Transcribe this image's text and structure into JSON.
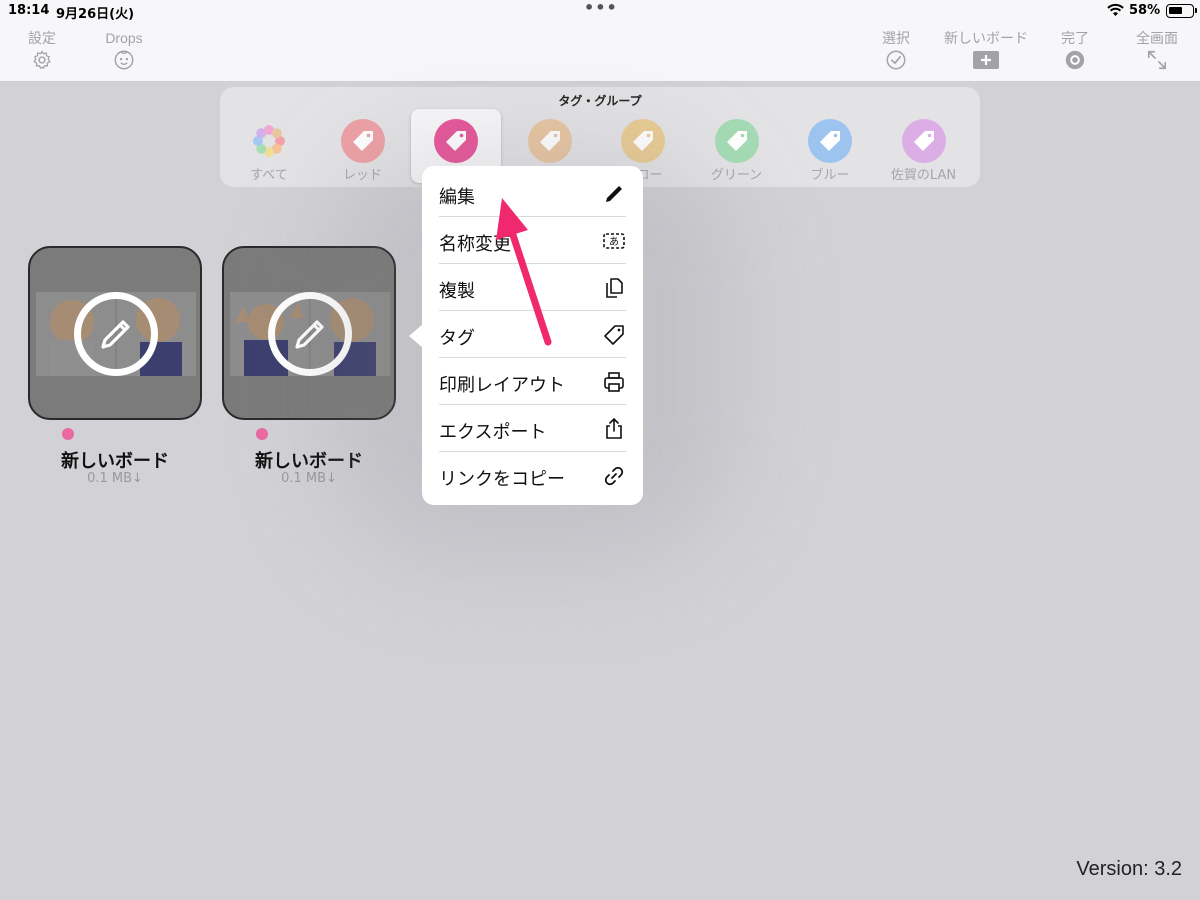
{
  "status_bar": {
    "time": "18:14",
    "date": "9月26日(火)",
    "dots": "•••",
    "battery_percent": "58%",
    "battery_level": 0.58
  },
  "toolbar": {
    "settings_label": "設定",
    "drops_label": "Drops",
    "select_label": "選択",
    "new_board_label": "新しいボード",
    "done_label": "完了",
    "fullscreen_label": "全画面",
    "icons": {
      "settings": "gear-icon",
      "drops": "face-icon",
      "select": "checkmark-circle-icon",
      "new_board": "plus-square-icon",
      "done": "done-circle-icon",
      "fullscreen": "expand-icon"
    }
  },
  "tag_group": {
    "title": "タグ・グループ",
    "tags": [
      {
        "label": "すべて",
        "color": "#cccccc",
        "icon": "all-tags-flower-icon"
      },
      {
        "label": "レッド",
        "color": "#eda0a6",
        "icon": "tag-icon"
      },
      {
        "label": "",
        "color": "#e8559a",
        "icon": "tag-icon",
        "selected": true
      },
      {
        "label": "",
        "color": "#e8c6a2",
        "icon": "tag-icon"
      },
      {
        "label": "エロー",
        "color": "#e9cc94",
        "icon": "tag-icon"
      },
      {
        "label": "グリーン",
        "color": "#a4dbb4",
        "icon": "tag-icon"
      },
      {
        "label": "ブルー",
        "color": "#9cc4ef",
        "icon": "tag-icon"
      },
      {
        "label": "佐賀のLAN",
        "color": "#dbaee6",
        "icon": "tag-icon"
      }
    ]
  },
  "boards": [
    {
      "name": "新しいボード",
      "size": "0.1 MB↓",
      "tag_color": "#e96aa1",
      "overlay_icon": "pencil-circle-icon"
    },
    {
      "name": "新しいボード",
      "size": "0.1 MB↓",
      "tag_color": "#e96aa1",
      "overlay_icon": "pencil-circle-icon"
    }
  ],
  "context_menu": {
    "items": [
      {
        "label": "編集",
        "icon": "pencil-icon"
      },
      {
        "label": "名称変更",
        "icon": "rename-text-icon"
      },
      {
        "label": "複製",
        "icon": "duplicate-icon"
      },
      {
        "label": "タグ",
        "icon": "tag-icon"
      },
      {
        "label": "印刷レイアウト",
        "icon": "printer-icon"
      },
      {
        "label": "エクスポート",
        "icon": "share-icon"
      },
      {
        "label": "リンクをコピー",
        "icon": "link-icon"
      }
    ]
  },
  "annotation_arrow_color": "#f0286e",
  "version": "Version: 3.2"
}
